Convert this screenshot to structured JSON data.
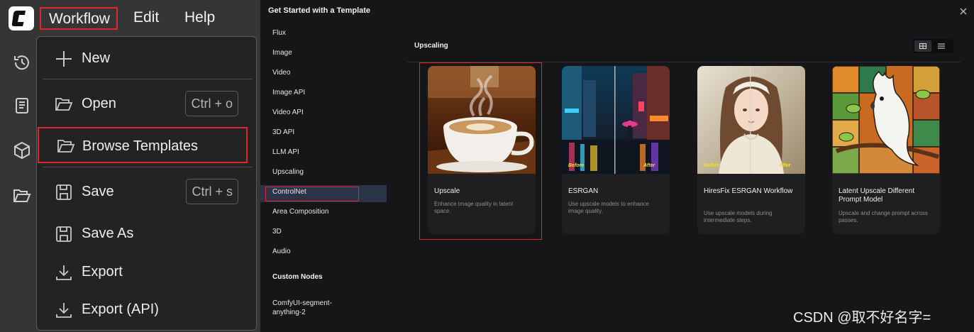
{
  "menubar": {
    "items": [
      {
        "label": "Workflow"
      },
      {
        "label": "Edit"
      },
      {
        "label": "Help"
      }
    ]
  },
  "side_toolbar": {
    "icons": [
      "history-icon",
      "book-icon",
      "cube-icon",
      "folder-icon"
    ]
  },
  "dropdown": {
    "items": [
      {
        "label": "New",
        "icon": "plus-icon"
      },
      {
        "label": "Open",
        "icon": "folder-open-icon",
        "shortcut": "Ctrl + o"
      },
      {
        "label": "Browse Templates",
        "icon": "folder-open-icon"
      },
      {
        "label": "Save",
        "icon": "save-icon",
        "shortcut": "Ctrl + s"
      },
      {
        "label": "Save As",
        "icon": "save-icon"
      },
      {
        "label": "Export",
        "icon": "download-icon"
      },
      {
        "label": "Export (API)",
        "icon": "download-icon"
      }
    ]
  },
  "dialog": {
    "title": "Get Started with a Template",
    "categories": [
      "Flux",
      "Image",
      "Video",
      "Image API",
      "Video API",
      "3D API",
      "LLM API",
      "Upscaling",
      "ControlNet",
      "Area Composition",
      "3D",
      "Audio"
    ],
    "selected_category": "Upscaling",
    "custom_nodes_heading": "Custom Nodes",
    "custom_nodes": [
      "ComfyUI-segment-anything-2"
    ],
    "content_title": "Upscaling",
    "view_mode": "grid",
    "cards": [
      {
        "title": "Upscale",
        "desc": "Enhance image quality in latent space."
      },
      {
        "title": "ESRGAN",
        "desc": "Use upscale models to enhance image quality.",
        "before": "Before",
        "after": "After"
      },
      {
        "title": "HiresFix ESRGAN Workflow",
        "desc": "Use upscale models during intermediate steps.",
        "before": "Before",
        "after": "After"
      },
      {
        "title": "Latent Upscale Different Prompt Model",
        "desc": "Upscale and change prompt across passes."
      }
    ]
  },
  "watermark": "CSDN @取不好名字=",
  "colors": {
    "highlight": "#e0262b",
    "selected_bg": "#2b3447",
    "before_after": "#f5e21e"
  }
}
